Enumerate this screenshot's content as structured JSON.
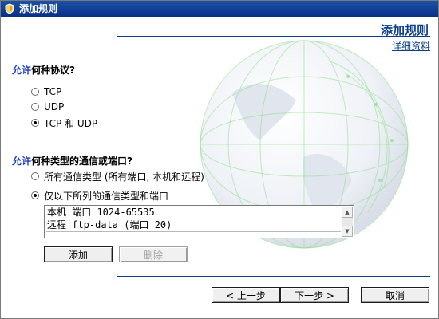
{
  "window": {
    "title": "添加规则"
  },
  "header": {
    "title": "添加规则",
    "details_link": "详细资料"
  },
  "protocol": {
    "question_prefix": "允许",
    "question_rest": "何种协议?",
    "options": [
      "TCP",
      "UDP",
      "TCP 和 UDP"
    ],
    "selected": "TCP 和 UDP"
  },
  "traffic": {
    "question_prefix": "允许",
    "question_rest": "何种类型的通信或端口?",
    "options": [
      "所有通信类型 (所有端口, 本机和远程)",
      "仅以下所列的通信类型和端口"
    ],
    "selected": "仅以下所列的通信类型和端口",
    "list_items": [
      "本机 端口 1024-65535",
      "远程 ftp-data (端口 20)"
    ]
  },
  "buttons": {
    "add": "添加",
    "delete": "删除",
    "prev": "< 上一步",
    "next": "下一步 >",
    "cancel": "取消"
  },
  "colors": {
    "titlebar": "#0a2f86",
    "accent": "#0a3d8a",
    "highlight": "#1c3fbf"
  },
  "icons": {
    "title_icon": "shield-icon",
    "scroll_up": "arrow-up-icon",
    "scroll_down": "arrow-down-icon"
  }
}
